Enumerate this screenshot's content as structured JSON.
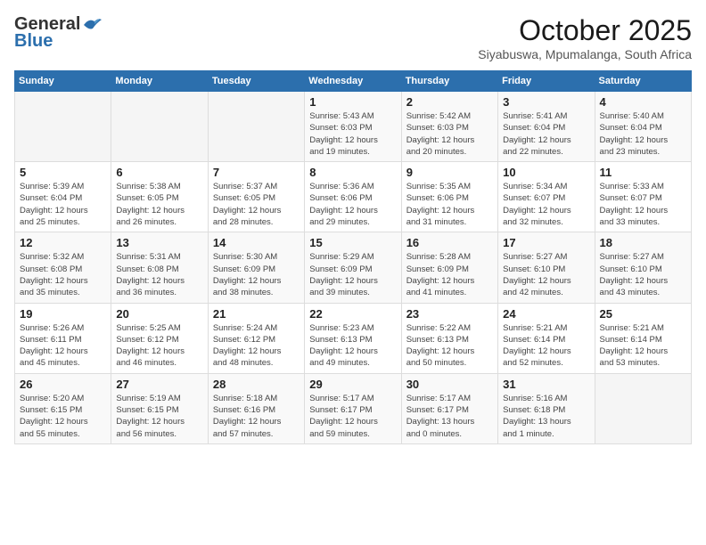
{
  "header": {
    "logo_general": "General",
    "logo_blue": "Blue",
    "month_title": "October 2025",
    "subtitle": "Siyabuswa, Mpumalanga, South Africa"
  },
  "days_of_week": [
    "Sunday",
    "Monday",
    "Tuesday",
    "Wednesday",
    "Thursday",
    "Friday",
    "Saturday"
  ],
  "weeks": [
    [
      {
        "day": "",
        "info": ""
      },
      {
        "day": "",
        "info": ""
      },
      {
        "day": "",
        "info": ""
      },
      {
        "day": "1",
        "info": "Sunrise: 5:43 AM\nSunset: 6:03 PM\nDaylight: 12 hours\nand 19 minutes."
      },
      {
        "day": "2",
        "info": "Sunrise: 5:42 AM\nSunset: 6:03 PM\nDaylight: 12 hours\nand 20 minutes."
      },
      {
        "day": "3",
        "info": "Sunrise: 5:41 AM\nSunset: 6:04 PM\nDaylight: 12 hours\nand 22 minutes."
      },
      {
        "day": "4",
        "info": "Sunrise: 5:40 AM\nSunset: 6:04 PM\nDaylight: 12 hours\nand 23 minutes."
      }
    ],
    [
      {
        "day": "5",
        "info": "Sunrise: 5:39 AM\nSunset: 6:04 PM\nDaylight: 12 hours\nand 25 minutes."
      },
      {
        "day": "6",
        "info": "Sunrise: 5:38 AM\nSunset: 6:05 PM\nDaylight: 12 hours\nand 26 minutes."
      },
      {
        "day": "7",
        "info": "Sunrise: 5:37 AM\nSunset: 6:05 PM\nDaylight: 12 hours\nand 28 minutes."
      },
      {
        "day": "8",
        "info": "Sunrise: 5:36 AM\nSunset: 6:06 PM\nDaylight: 12 hours\nand 29 minutes."
      },
      {
        "day": "9",
        "info": "Sunrise: 5:35 AM\nSunset: 6:06 PM\nDaylight: 12 hours\nand 31 minutes."
      },
      {
        "day": "10",
        "info": "Sunrise: 5:34 AM\nSunset: 6:07 PM\nDaylight: 12 hours\nand 32 minutes."
      },
      {
        "day": "11",
        "info": "Sunrise: 5:33 AM\nSunset: 6:07 PM\nDaylight: 12 hours\nand 33 minutes."
      }
    ],
    [
      {
        "day": "12",
        "info": "Sunrise: 5:32 AM\nSunset: 6:08 PM\nDaylight: 12 hours\nand 35 minutes."
      },
      {
        "day": "13",
        "info": "Sunrise: 5:31 AM\nSunset: 6:08 PM\nDaylight: 12 hours\nand 36 minutes."
      },
      {
        "day": "14",
        "info": "Sunrise: 5:30 AM\nSunset: 6:09 PM\nDaylight: 12 hours\nand 38 minutes."
      },
      {
        "day": "15",
        "info": "Sunrise: 5:29 AM\nSunset: 6:09 PM\nDaylight: 12 hours\nand 39 minutes."
      },
      {
        "day": "16",
        "info": "Sunrise: 5:28 AM\nSunset: 6:09 PM\nDaylight: 12 hours\nand 41 minutes."
      },
      {
        "day": "17",
        "info": "Sunrise: 5:27 AM\nSunset: 6:10 PM\nDaylight: 12 hours\nand 42 minutes."
      },
      {
        "day": "18",
        "info": "Sunrise: 5:27 AM\nSunset: 6:10 PM\nDaylight: 12 hours\nand 43 minutes."
      }
    ],
    [
      {
        "day": "19",
        "info": "Sunrise: 5:26 AM\nSunset: 6:11 PM\nDaylight: 12 hours\nand 45 minutes."
      },
      {
        "day": "20",
        "info": "Sunrise: 5:25 AM\nSunset: 6:12 PM\nDaylight: 12 hours\nand 46 minutes."
      },
      {
        "day": "21",
        "info": "Sunrise: 5:24 AM\nSunset: 6:12 PM\nDaylight: 12 hours\nand 48 minutes."
      },
      {
        "day": "22",
        "info": "Sunrise: 5:23 AM\nSunset: 6:13 PM\nDaylight: 12 hours\nand 49 minutes."
      },
      {
        "day": "23",
        "info": "Sunrise: 5:22 AM\nSunset: 6:13 PM\nDaylight: 12 hours\nand 50 minutes."
      },
      {
        "day": "24",
        "info": "Sunrise: 5:21 AM\nSunset: 6:14 PM\nDaylight: 12 hours\nand 52 minutes."
      },
      {
        "day": "25",
        "info": "Sunrise: 5:21 AM\nSunset: 6:14 PM\nDaylight: 12 hours\nand 53 minutes."
      }
    ],
    [
      {
        "day": "26",
        "info": "Sunrise: 5:20 AM\nSunset: 6:15 PM\nDaylight: 12 hours\nand 55 minutes."
      },
      {
        "day": "27",
        "info": "Sunrise: 5:19 AM\nSunset: 6:15 PM\nDaylight: 12 hours\nand 56 minutes."
      },
      {
        "day": "28",
        "info": "Sunrise: 5:18 AM\nSunset: 6:16 PM\nDaylight: 12 hours\nand 57 minutes."
      },
      {
        "day": "29",
        "info": "Sunrise: 5:17 AM\nSunset: 6:17 PM\nDaylight: 12 hours\nand 59 minutes."
      },
      {
        "day": "30",
        "info": "Sunrise: 5:17 AM\nSunset: 6:17 PM\nDaylight: 13 hours\nand 0 minutes."
      },
      {
        "day": "31",
        "info": "Sunrise: 5:16 AM\nSunset: 6:18 PM\nDaylight: 13 hours\nand 1 minute."
      },
      {
        "day": "",
        "info": ""
      }
    ]
  ]
}
